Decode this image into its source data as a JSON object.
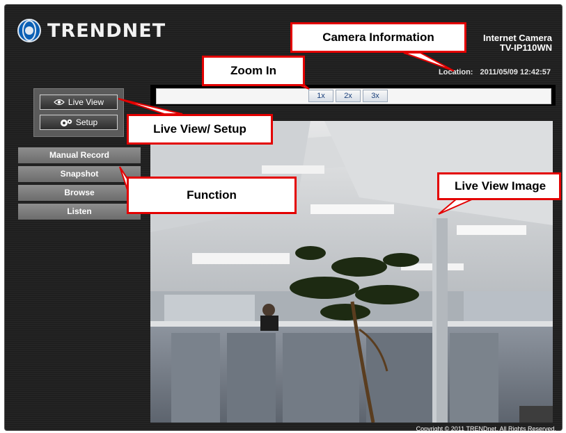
{
  "brand": {
    "logo_text": "TRENDNET",
    "logo_icon": "trendnet-globe-icon"
  },
  "camera": {
    "line1": "Internet Camera",
    "line2": "TV-IP110WN"
  },
  "location": {
    "label": "Location:",
    "value": "2011/05/09 12:42:57"
  },
  "zoom": {
    "buttons": [
      "1x",
      "2x",
      "3x"
    ]
  },
  "nav": {
    "live_view": {
      "label": "Live View",
      "icon": "eye-icon"
    },
    "setup": {
      "label": "Setup",
      "icon": "gears-icon"
    }
  },
  "functions": [
    "Manual Record",
    "Snapshot",
    "Browse",
    "Listen"
  ],
  "footer": {
    "copyright": "Copyright © 2011 TRENDnet. All Rights Reserved."
  },
  "callouts": {
    "camera_info": "Camera Information",
    "zoom_in": "Zoom In",
    "live_view_setup": "Live View/ Setup",
    "function": "Function",
    "live_view_image": "Live View Image"
  },
  "colors": {
    "callout_border": "#e30000",
    "background": "#1f1f1f",
    "zoom_text": "#1a3f7a"
  }
}
